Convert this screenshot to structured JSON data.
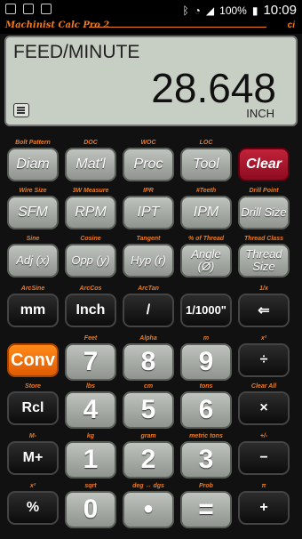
{
  "status": {
    "battery": "100%",
    "time": "10:09"
  },
  "brand": {
    "name": "Machinist Calc Pro 2",
    "ci": "ci"
  },
  "display": {
    "label": "FEED/MINUTE",
    "value": "28.648",
    "unit": "INCH"
  },
  "rows": [
    {
      "subs": [
        "Bolt Pattern",
        "DOC",
        "WOC",
        "LOC",
        ""
      ],
      "keys": [
        "Diam",
        "Mat'l",
        "Proc",
        "Tool",
        "Clear"
      ]
    },
    {
      "subs": [
        "Wire Size",
        "3W Measure",
        "IPR",
        "#Teeth",
        "Drill Point"
      ],
      "keys": [
        "SFM",
        "RPM",
        "IPT",
        "IPM",
        "Drill Size"
      ]
    },
    {
      "subs": [
        "Sine",
        "Cosine",
        "Tangent",
        "% of Thread",
        "Thread Class"
      ],
      "keys": [
        "Adj (x)",
        "Opp (y)",
        "Hyp (r)",
        "Angle (Ø)",
        "Thread Size"
      ]
    },
    {
      "subs": [
        "ArcSine",
        "ArcCos",
        "ArcTan",
        "",
        "1/x"
      ],
      "keys": [
        "mm",
        "Inch",
        "/",
        "1/1000\"",
        "⇐"
      ]
    },
    {
      "subs": [
        "",
        "Feet",
        "Alpha",
        "m",
        "x²"
      ],
      "keys": [
        "Conv",
        "7",
        "8",
        "9",
        "÷"
      ]
    },
    {
      "subs": [
        "Store",
        "lbs",
        "cm",
        "tons",
        "Clear All"
      ],
      "keys": [
        "Rcl",
        "4",
        "5",
        "6",
        "×"
      ]
    },
    {
      "subs": [
        "M-",
        "kg",
        "gram",
        "metric tons",
        "+/-"
      ],
      "keys": [
        "M+",
        "1",
        "2",
        "3",
        "−"
      ]
    },
    {
      "subs": [
        "x²",
        "sqrt",
        "deg ↔ dgs",
        "Prob",
        "π"
      ],
      "keys": [
        "%",
        "0",
        "•",
        "=",
        "+"
      ]
    }
  ]
}
